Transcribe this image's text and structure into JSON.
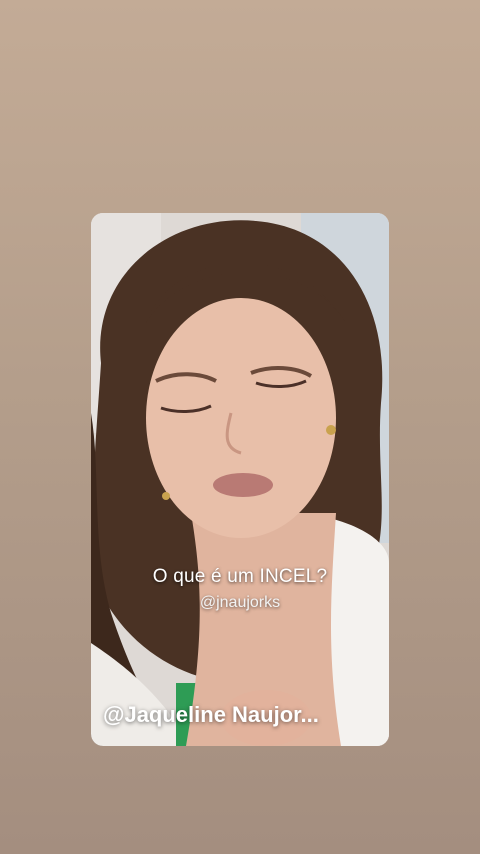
{
  "story": {
    "video_caption_title": "O que é um INCEL?",
    "video_caption_handle": "@jnaujorks",
    "mention_sticker": "@Jaqueline Naujor..."
  }
}
